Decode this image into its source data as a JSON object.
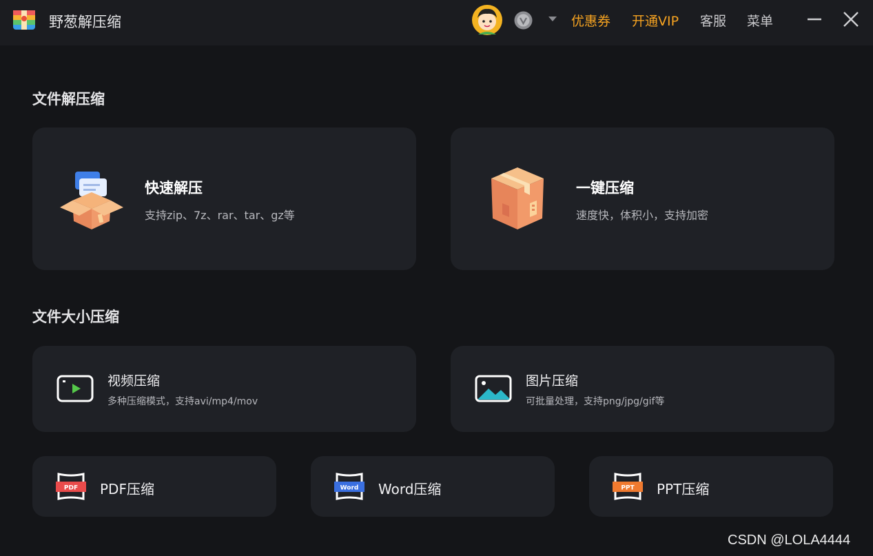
{
  "app": {
    "title": "野葱解压缩"
  },
  "header": {
    "coupon": "优惠券",
    "vip": "开通VIP",
    "service": "客服",
    "menu": "菜单",
    "accent_color": "#f6a321"
  },
  "sections": {
    "extract": "文件解压缩",
    "size": "文件大小压缩"
  },
  "cards": {
    "quick_extract": {
      "title": "快速解压",
      "desc": "支持zip、7z、rar、tar、gz等"
    },
    "one_click": {
      "title": "一键压缩",
      "desc": "速度快，体积小，支持加密"
    },
    "video": {
      "title": "视频压缩",
      "desc": "多种压缩模式，支持avi/mp4/mov"
    },
    "image": {
      "title": "图片压缩",
      "desc": "可批量处理，支持png/jpg/gif等"
    },
    "pdf": {
      "title": "PDF压缩",
      "badge": "PDF"
    },
    "word": {
      "title": "Word压缩",
      "badge": "Word"
    },
    "ppt": {
      "title": "PPT压缩",
      "badge": "PPT"
    }
  },
  "watermark": "CSDN @LOLA4444",
  "icons": [
    "app-logo-icon",
    "avatar",
    "vip-badge-icon",
    "caret-down-icon",
    "minimize-icon",
    "close-icon",
    "open-box-icon",
    "package-icon",
    "video-icon",
    "image-icon",
    "pdf-icon",
    "word-icon",
    "ppt-icon"
  ]
}
